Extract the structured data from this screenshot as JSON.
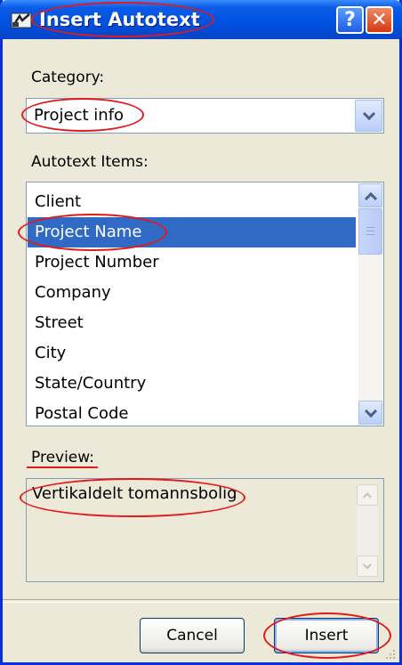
{
  "window": {
    "title": "Insert Autotext",
    "help_label": "?",
    "close_label": "✕"
  },
  "category": {
    "label": "Category:",
    "selected": "Project info"
  },
  "items": {
    "label": "Autotext Items:",
    "list": [
      "Client",
      "Project Name",
      "Project Number",
      "Company",
      "Street",
      "City",
      "State/Country",
      "Postal Code"
    ],
    "selected_index": 1
  },
  "preview": {
    "label": "Preview:",
    "text": "Vertikaldelt tomannsbolig"
  },
  "buttons": {
    "cancel": "Cancel",
    "insert": "Insert"
  },
  "colors": {
    "title_bar": "#0052E1",
    "selection": "#316AC5",
    "annotation": "#E31A1A",
    "dialog_bg": "#ECE9D8"
  }
}
